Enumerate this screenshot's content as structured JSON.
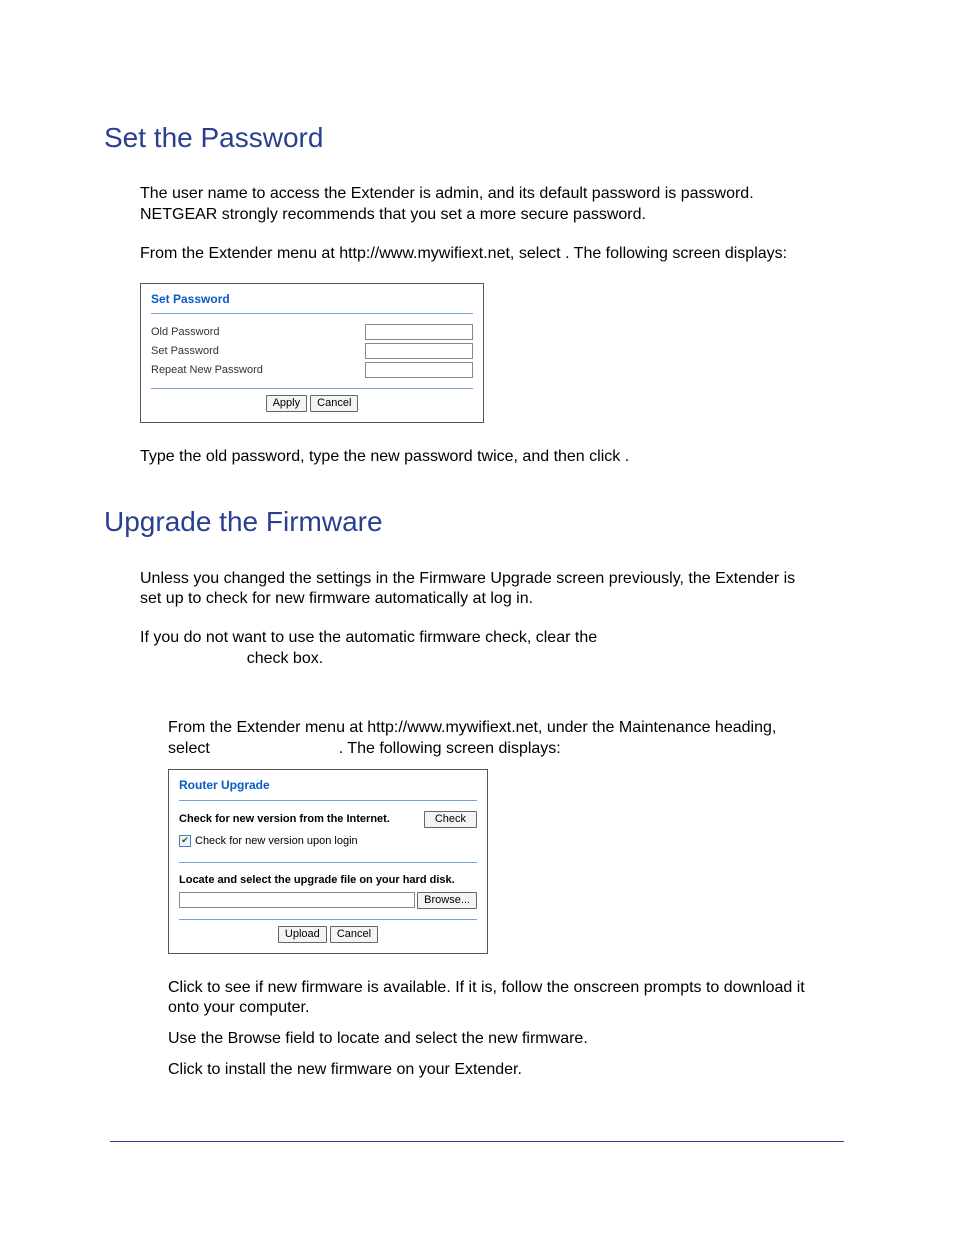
{
  "section1": {
    "heading": "Set the Password",
    "p1": "The user name to access the Extender is admin, and its default password is password. NETGEAR strongly recommends that you set a more secure password.",
    "p2a": "From the Extender menu at http://www.mywifiext.net, select ",
    "p2b": ". The following screen displays:",
    "panel": {
      "title": "Set Password",
      "old_label": "Old Password",
      "set_label": "Set Password",
      "repeat_label": "Repeat New Password",
      "apply": "Apply",
      "cancel": "Cancel"
    },
    "p3": "Type the old password, type the new password twice, and then click             ."
  },
  "section2": {
    "heading": "Upgrade the Firmware",
    "p1": "Unless you changed the settings in the Firmware Upgrade screen previously, the Extender is set up to check for new firmware automatically at log in.",
    "p2a": "If you do not want to use the automatic firmware check, clear the ",
    "p2b": "                        check box.",
    "step1a": "From the Extender menu at http://www.mywifiext.net, under the Maintenance heading, select ",
    "step1b": ". The following screen displays:",
    "panel": {
      "title": "Router Upgrade",
      "check_label": "Check for new version from the Internet.",
      "check_btn": "Check",
      "checkbox_label": "Check for new version upon login",
      "locate_label": "Locate and select the upgrade file on your hard disk.",
      "browse_btn": "Browse...",
      "upload": "Upload",
      "cancel": "Cancel"
    },
    "step2": "Click              to see if new firmware is available. If it is, follow the onscreen prompts to download it onto your computer.",
    "step3": "Use the Browse field to locate and select the new firmware.",
    "step4": "Click              to install the new firmware on your Extender."
  }
}
